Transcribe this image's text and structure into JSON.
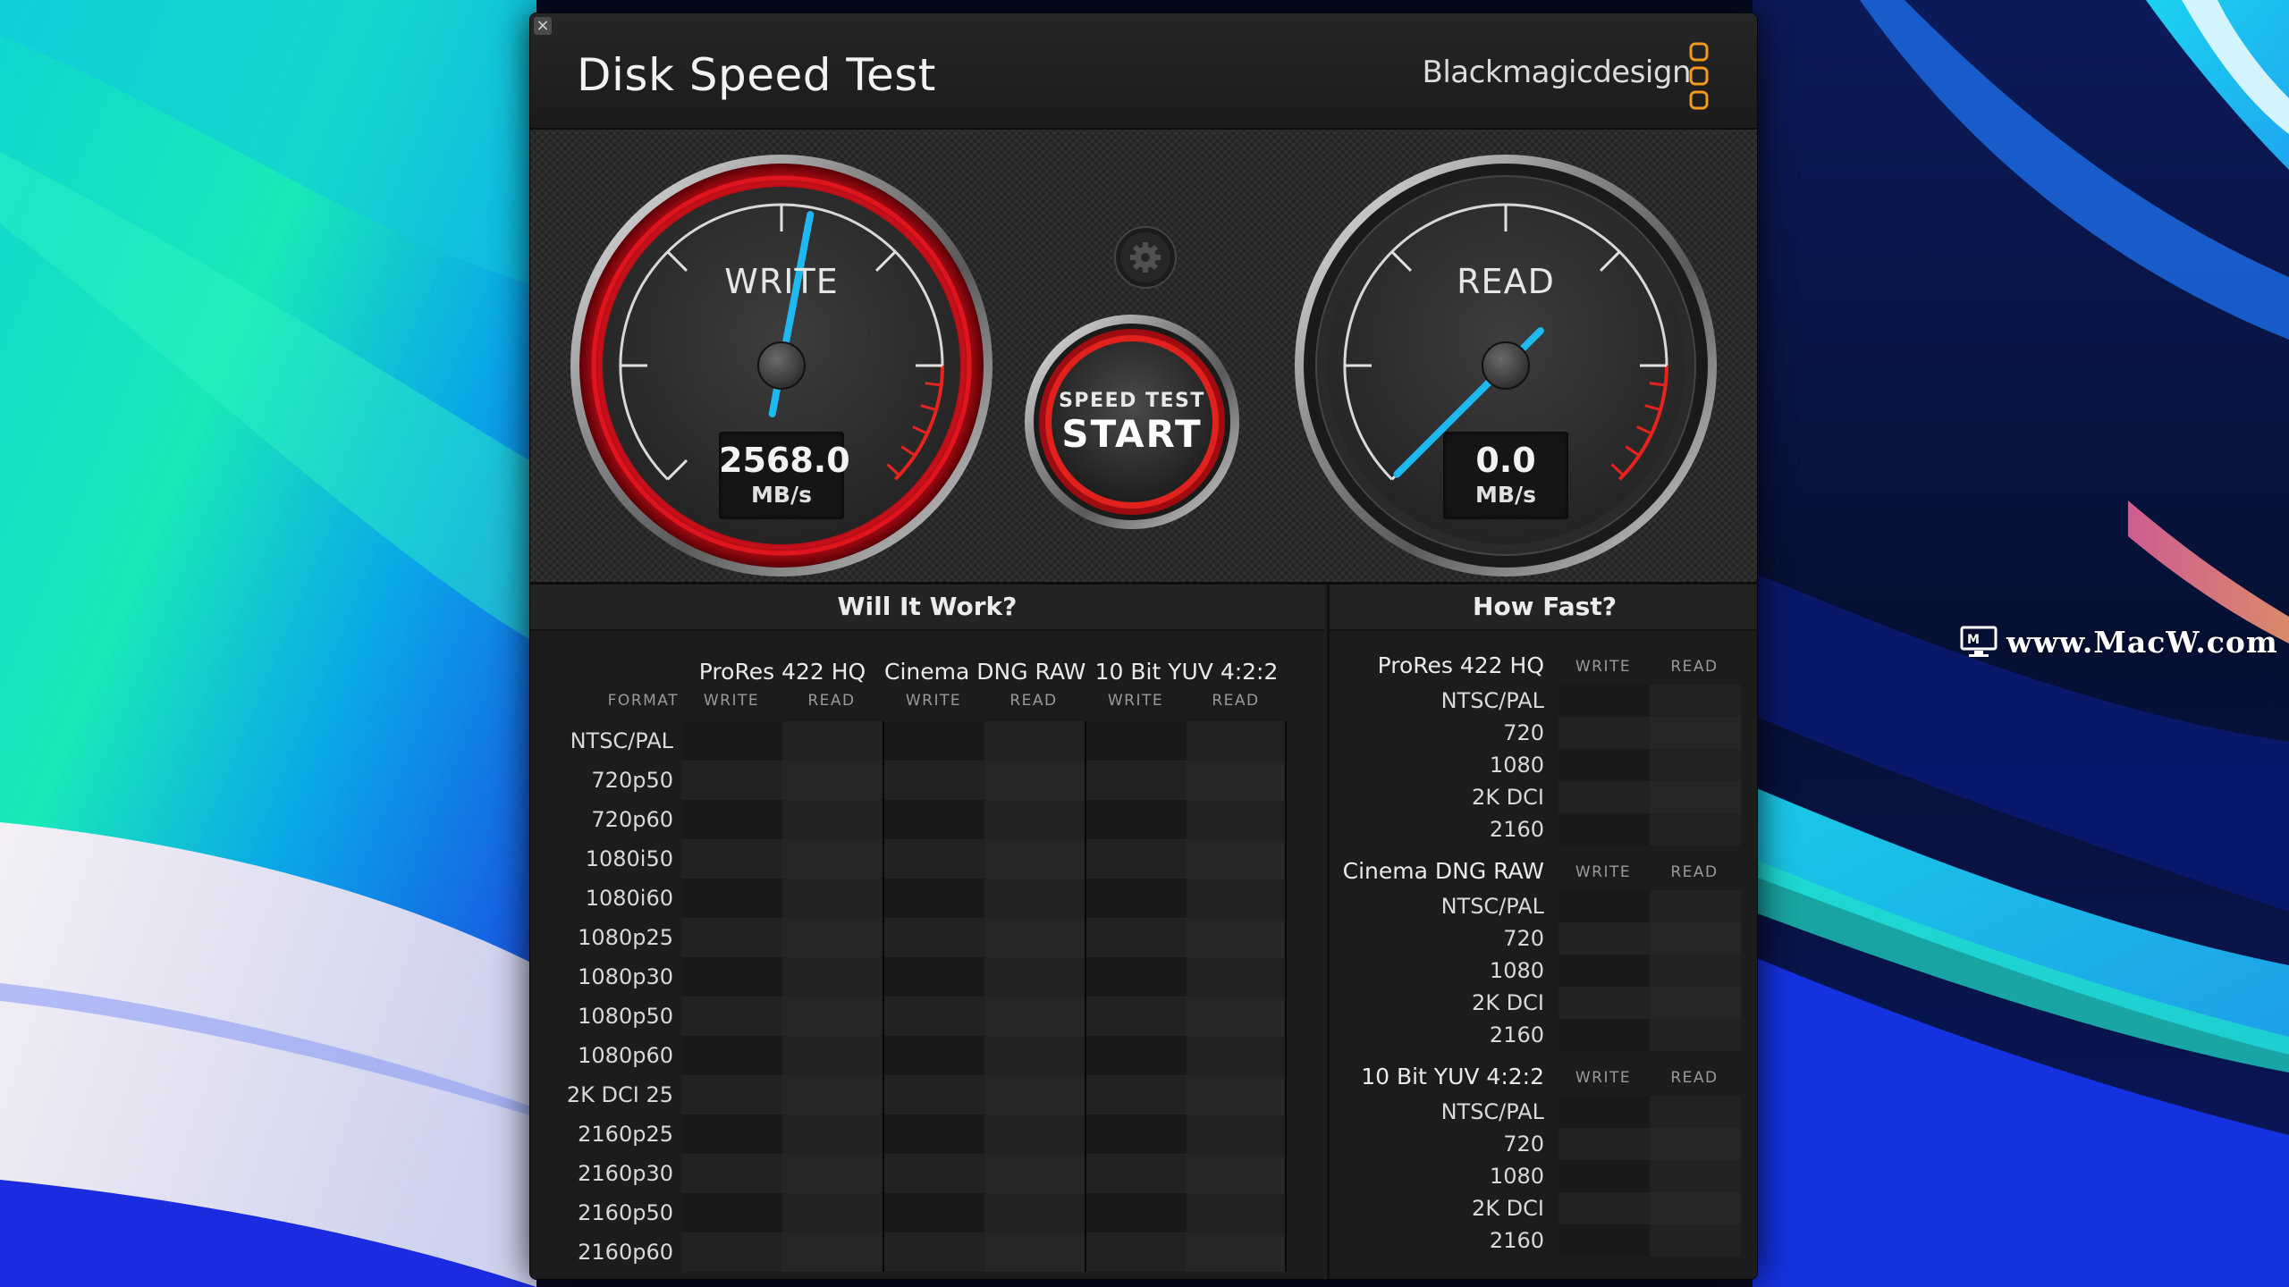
{
  "window": {
    "title": "Disk Speed Test",
    "brand": "Blackmagicdesign",
    "close_glyph": "×"
  },
  "gauges": {
    "write": {
      "label": "WRITE",
      "value": "2568.0",
      "unit": "MB/s",
      "needle_fraction": 0.54
    },
    "read": {
      "label": "READ",
      "value": "0.0",
      "unit": "MB/s",
      "needle_fraction": 0.0
    }
  },
  "start_button": {
    "top_label": "SPEED TEST",
    "main_label": "START"
  },
  "settings_icon": "gear-icon",
  "will_it_work": {
    "title": "Will It Work?",
    "format_header": "FORMAT",
    "codecs": [
      {
        "name": "ProRes 422 HQ",
        "write": "WRITE",
        "read": "READ"
      },
      {
        "name": "Cinema DNG RAW",
        "write": "WRITE",
        "read": "READ"
      },
      {
        "name": "10 Bit YUV 4:2:2",
        "write": "WRITE",
        "read": "READ"
      }
    ],
    "formats": [
      "NTSC/PAL",
      "720p50",
      "720p60",
      "1080i50",
      "1080i60",
      "1080p25",
      "1080p30",
      "1080p50",
      "1080p60",
      "2K DCI 25",
      "2160p25",
      "2160p30",
      "2160p50",
      "2160p60"
    ]
  },
  "how_fast": {
    "title": "How Fast?",
    "groups": [
      {
        "name": "ProRes 422 HQ",
        "write": "WRITE",
        "read": "READ",
        "rows": [
          "NTSC/PAL",
          "720",
          "1080",
          "2K DCI",
          "2160"
        ]
      },
      {
        "name": "Cinema DNG RAW",
        "write": "WRITE",
        "read": "READ",
        "rows": [
          "NTSC/PAL",
          "720",
          "1080",
          "2K DCI",
          "2160"
        ]
      },
      {
        "name": "10 Bit YUV 4:2:2",
        "write": "WRITE",
        "read": "READ",
        "rows": [
          "NTSC/PAL",
          "720",
          "1080",
          "2K DCI",
          "2160"
        ]
      }
    ]
  },
  "watermark": {
    "text": "www.MacW.com"
  },
  "colors": {
    "needle": "#1fb8f0",
    "write_ring": "#d8141c",
    "redline": "#e8231e",
    "wallpaper_cyan": "#17e6c3",
    "wallpaper_blue": "#1c2ff0"
  }
}
